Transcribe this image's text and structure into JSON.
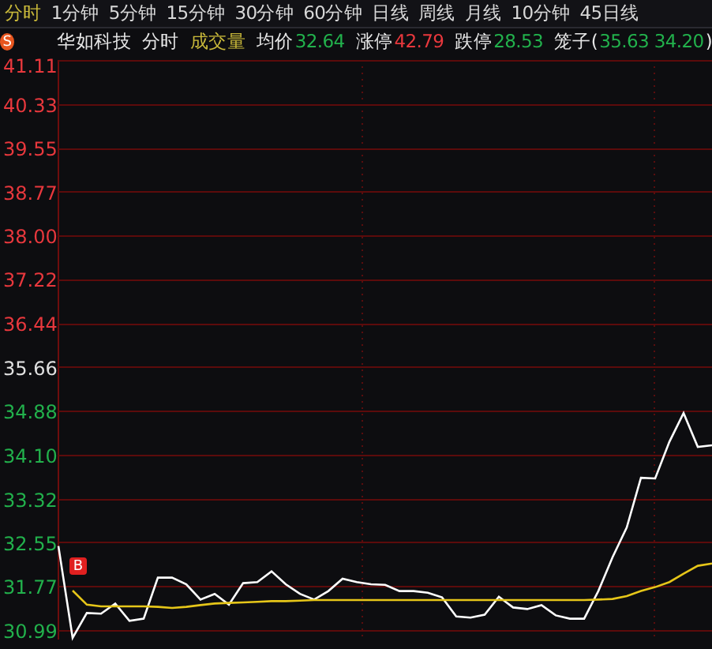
{
  "periods": [
    {
      "label": "分时",
      "selected": true
    },
    {
      "label": "1分钟",
      "selected": false
    },
    {
      "label": "5分钟",
      "selected": false
    },
    {
      "label": "15分钟",
      "selected": false
    },
    {
      "label": "30分钟",
      "selected": false
    },
    {
      "label": "60分钟",
      "selected": false
    },
    {
      "label": "日线",
      "selected": false
    },
    {
      "label": "周线",
      "selected": false
    },
    {
      "label": "月线",
      "selected": false
    },
    {
      "label": "10分钟",
      "selected": false
    },
    {
      "label": "45日线",
      "selected": false
    }
  ],
  "header": {
    "badge": "S",
    "items": [
      {
        "kind": "title",
        "text": "华如科技"
      },
      {
        "kind": "mode",
        "text": "分时"
      },
      {
        "kind": "indicator",
        "text": "成交量"
      },
      {
        "kind": "stat",
        "label": "均价",
        "value": "32.64",
        "color": "#22b14c"
      },
      {
        "kind": "stat",
        "label": "涨停",
        "value": "42.79",
        "color": "#e8383d"
      },
      {
        "kind": "stat",
        "label": "跌停",
        "value": "28.53",
        "color": "#22b14c"
      },
      {
        "kind": "range",
        "label": "笼子(",
        "value": "35.63 34.20",
        "suffix": ")",
        "color": "#22b14c"
      }
    ]
  },
  "chart": {
    "markers": [
      {
        "text": "B"
      }
    ],
    "chart_data": {
      "type": "line",
      "grid": true,
      "ylim": [
        30.82,
        41.11
      ],
      "categories": [
        null,
        null,
        null,
        null,
        null,
        null,
        null,
        null,
        null,
        null,
        null,
        null,
        null,
        null,
        null,
        null,
        null,
        null,
        null,
        null,
        null,
        null,
        null,
        null,
        null,
        null,
        null,
        null,
        null,
        null,
        null,
        null,
        null,
        null,
        null,
        null,
        null,
        null,
        null,
        null,
        null,
        null,
        null,
        null,
        null,
        null,
        null
      ],
      "yticks": [
        {
          "value": 41.11,
          "label": "41.11"
        },
        {
          "value": 40.33,
          "label": "40.33"
        },
        {
          "value": 39.55,
          "label": "39.55"
        },
        {
          "value": 38.77,
          "label": "38.77"
        },
        {
          "value": 38.0,
          "label": "38.00"
        },
        {
          "value": 37.22,
          "label": "37.22"
        },
        {
          "value": 36.44,
          "label": "36.44"
        },
        {
          "value": 35.66,
          "label": "35.66"
        },
        {
          "value": 34.88,
          "label": "34.88"
        },
        {
          "value": 34.1,
          "label": "34.10"
        },
        {
          "value": 33.32,
          "label": "33.32"
        },
        {
          "value": 32.55,
          "label": "32.55"
        },
        {
          "value": 31.77,
          "label": "31.77"
        },
        {
          "value": 30.99,
          "label": "30.99"
        }
      ],
      "series": [
        {
          "color": "#ffffff",
          "values": [
            32.48,
            30.85,
            31.29,
            31.28,
            31.46,
            31.15,
            31.19,
            31.92,
            31.92,
            31.8,
            31.53,
            31.63,
            31.44,
            31.82,
            31.84,
            32.03,
            31.8,
            31.63,
            31.53,
            31.68,
            31.9,
            31.84,
            31.8,
            31.79,
            31.68,
            31.68,
            31.65,
            31.57,
            31.23,
            31.21,
            31.26,
            31.58,
            31.39,
            31.36,
            31.43,
            31.25,
            31.19,
            31.19,
            31.68,
            32.28,
            32.81,
            33.69,
            33.68,
            34.33,
            34.84,
            34.24,
            34.27
          ]
        },
        {
          "color": "#e6c619",
          "values": [
            null,
            31.69,
            31.44,
            31.41,
            31.41,
            31.41,
            31.41,
            31.4,
            31.38,
            31.4,
            31.43,
            31.46,
            31.47,
            31.48,
            31.49,
            31.5,
            31.5,
            31.51,
            31.52,
            31.52,
            31.52,
            31.52,
            31.52,
            31.52,
            31.52,
            31.52,
            31.52,
            31.52,
            31.52,
            31.52,
            31.52,
            31.52,
            31.52,
            31.52,
            31.52,
            31.52,
            31.52,
            31.52,
            31.53,
            31.54,
            31.59,
            31.68,
            31.75,
            31.84,
            31.99,
            32.13,
            32.17
          ]
        }
      ]
    }
  }
}
